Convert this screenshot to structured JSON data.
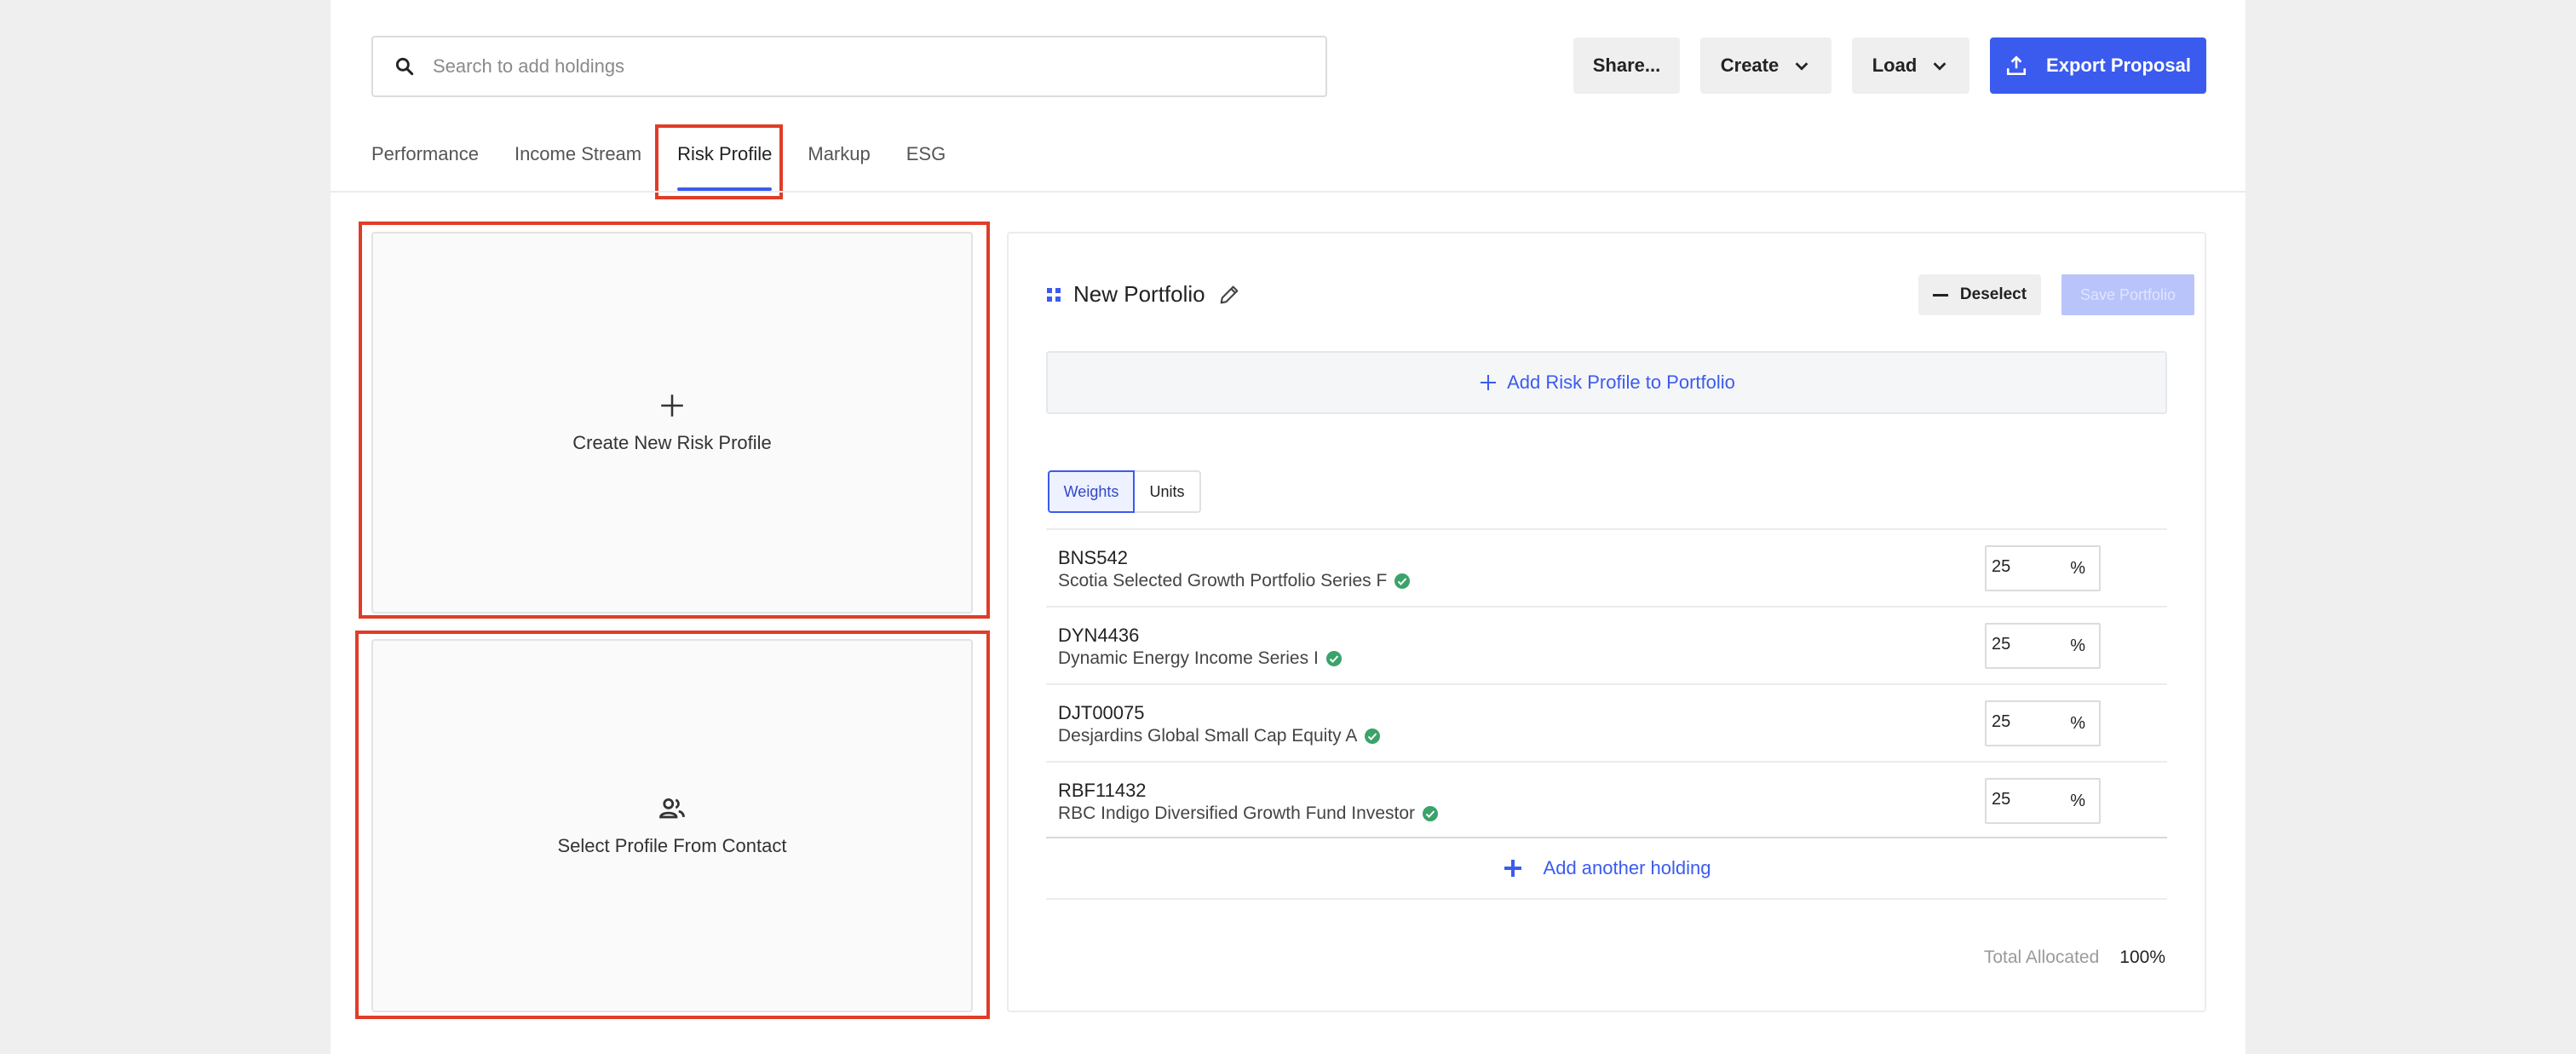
{
  "header": {
    "search_placeholder": "Search to add holdings",
    "share_label": "Share...",
    "create_label": "Create",
    "load_label": "Load",
    "export_label": "Export Proposal"
  },
  "tabs": [
    {
      "label": "Performance"
    },
    {
      "label": "Income Stream"
    },
    {
      "label": "Risk Profile",
      "active": true
    },
    {
      "label": "Markup"
    },
    {
      "label": "ESG"
    }
  ],
  "left": {
    "create_label": "Create New Risk Profile",
    "select_label": "Select Profile From Contact"
  },
  "portfolio": {
    "title": "New Portfolio",
    "deselect_label": "Deselect",
    "save_label": "Save Portfolio",
    "add_risk_label": "Add Risk Profile to Portfolio",
    "toggle": {
      "weights": "Weights",
      "units": "Units",
      "selected": "Weights"
    },
    "holdings": [
      {
        "code": "BNS542",
        "name": "Scotia Selected Growth Portfolio Series F",
        "weight": "25",
        "unit": "%"
      },
      {
        "code": "DYN4436",
        "name": "Dynamic Energy Income Series I",
        "weight": "25",
        "unit": "%"
      },
      {
        "code": "DJT00075",
        "name": "Desjardins Global Small Cap Equity A",
        "weight": "25",
        "unit": "%"
      },
      {
        "code": "RBF11432",
        "name": "RBC Indigo Diversified Growth Fund Investor",
        "weight": "25",
        "unit": "%"
      }
    ],
    "add_holding_label": "Add another holding",
    "total_label": "Total Allocated",
    "total_value": "100%"
  },
  "colors": {
    "accent": "#3b5bef",
    "highlight": "#e03c28",
    "verified": "#3aa36a"
  },
  "icons": [
    "search-icon",
    "chevron-down-icon",
    "upload-icon",
    "plus-icon",
    "people-icon",
    "grid-icon",
    "pencil-icon",
    "check-circle-icon"
  ]
}
